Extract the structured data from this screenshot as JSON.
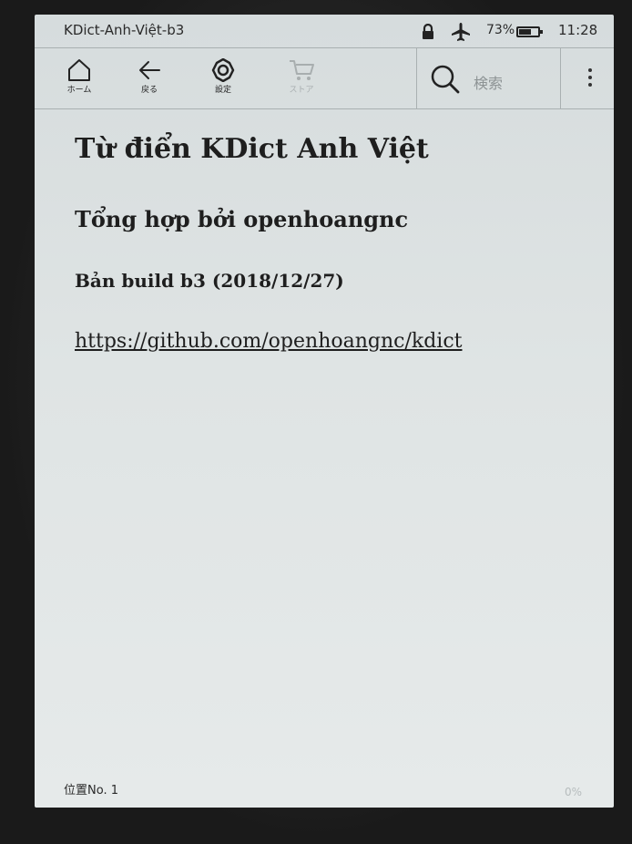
{
  "status_bar": {
    "book_title": "KDict-Anh-Việt-b3",
    "battery_percent": "73%",
    "battery_level": 0.73,
    "time": "11:28",
    "icons": [
      "lock-icon",
      "airplane-icon",
      "battery-icon"
    ]
  },
  "toolbar": {
    "home_label": "ホーム",
    "back_label": "戻る",
    "settings_label": "設定",
    "store_label": "ストア",
    "search_placeholder": "検索"
  },
  "content": {
    "title": "Từ điển KDict Anh Việt",
    "subtitle": "Tổng hợp bởi openhoangnc",
    "build": "Bản build b3 (2018/12/27)",
    "link": "https://github.com/openhoangnc/kdict"
  },
  "footer": {
    "location": "位置No. 1",
    "progress": "0%"
  }
}
